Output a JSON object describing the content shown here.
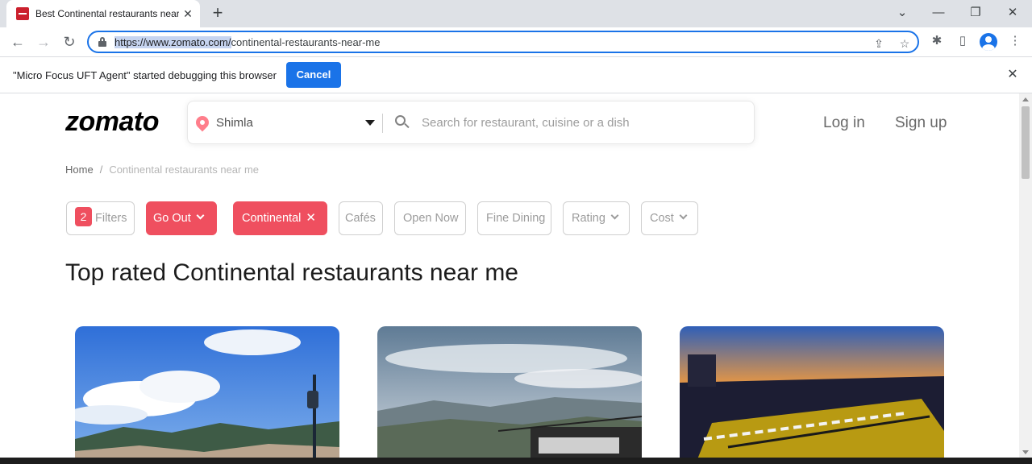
{
  "browser": {
    "tab_title": "Best Continental restaurants near me",
    "tab_close": "✕",
    "new_tab": "+",
    "url_host": "https://www.zomato.com/",
    "url_path": "continental-restaurants-near-me",
    "controls": {
      "tab_search": "⌄",
      "minimize": "—",
      "restore": "❐",
      "close": "✕"
    },
    "nav": {
      "back": "←",
      "forward": "→",
      "reload": "↻"
    }
  },
  "infobar": {
    "message": "\"Micro Focus UFT Agent\" started debugging this browser",
    "cancel_label": "Cancel",
    "close": "✕"
  },
  "site": {
    "logo": "zomato",
    "location": "Shimla",
    "search_placeholder": "Search for restaurant, cuisine or a dish",
    "login_label": "Log in",
    "signup_label": "Sign up",
    "accent_color": "#ef4f5f"
  },
  "breadcrumb": {
    "home": "Home",
    "separator": "/",
    "current": "Continental restaurants near me"
  },
  "filters": {
    "count": "2",
    "filters_label": "Filters",
    "go_out_label": "Go Out",
    "continental_label": "Continental",
    "cafes_label": "Cafés",
    "open_now_label": "Open Now",
    "fine_dining_label": "Fine Dining",
    "rating_label": "Rating",
    "cost_label": "Cost"
  },
  "heading": "Top rated Continental restaurants near me"
}
